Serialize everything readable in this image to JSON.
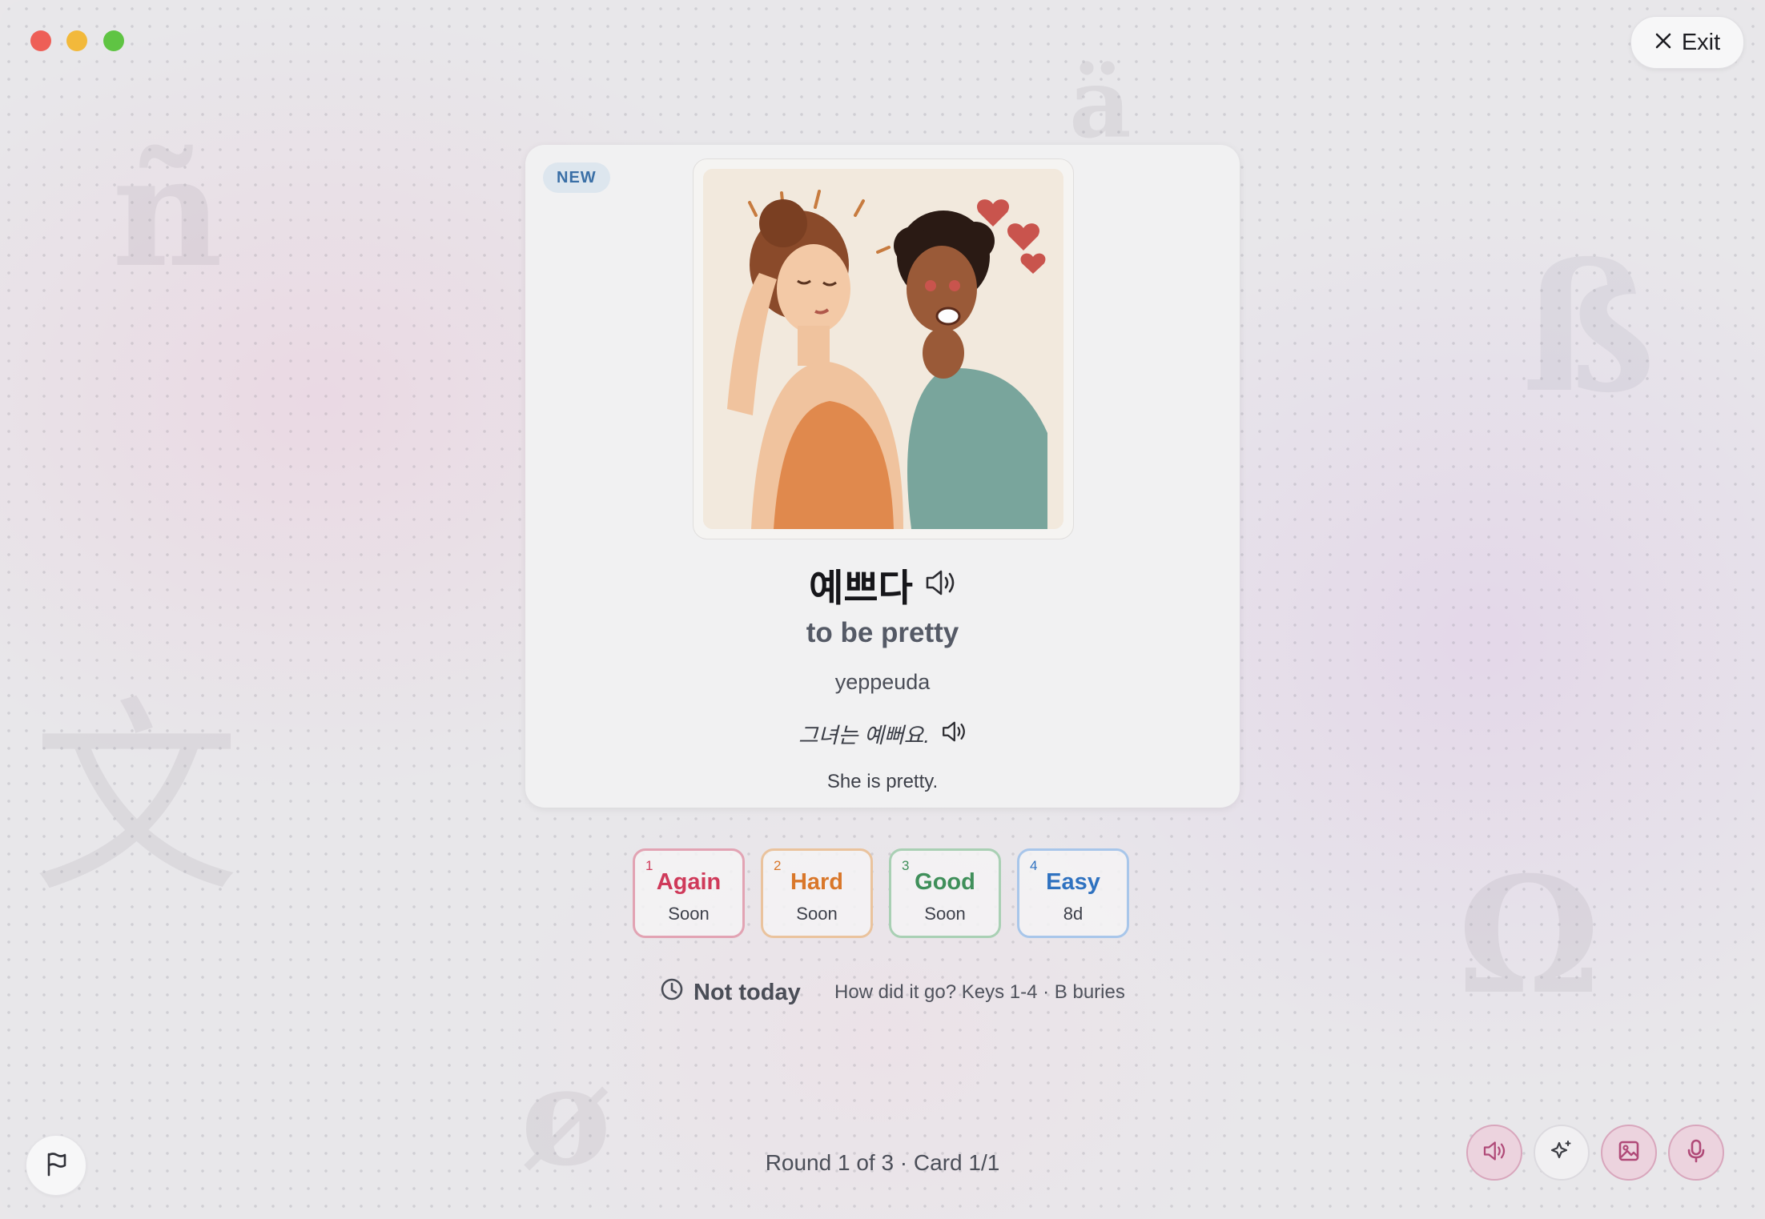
{
  "window": {
    "traffic_lights": {
      "close_color": "#ee5f57",
      "minimize_color": "#f2b93b",
      "maximize_color": "#5fc443"
    },
    "exit_label": "Exit"
  },
  "background": {
    "glyphs": [
      "ñ",
      "ß",
      "文",
      "Ω",
      "ø",
      "ä"
    ]
  },
  "card": {
    "badge": "NEW",
    "image": {
      "description_icon": "illustration-couple"
    },
    "word": "예쁘다",
    "meaning": "to be pretty",
    "romanization": "yeppeuda",
    "example": "그녀는 예뻐요.",
    "translation": "She is pretty."
  },
  "ratings": [
    {
      "key": "1",
      "label": "Again",
      "sub": "Soon",
      "color": "#cf3a5a"
    },
    {
      "key": "2",
      "label": "Hard",
      "sub": "Soon",
      "color": "#d9772a"
    },
    {
      "key": "3",
      "label": "Good",
      "sub": "Soon",
      "color": "#3f8f5a"
    },
    {
      "key": "4",
      "label": "Easy",
      "sub": "8d",
      "color": "#2f72c0"
    }
  ],
  "actions": {
    "not_today": "Not today",
    "hint": "How did it go? Keys 1-4 · B buries"
  },
  "footer": {
    "progress": "Round 1 of 3 · Card 1/1",
    "tools": [
      "speaker-icon",
      "sparkle-icon",
      "image-icon",
      "microphone-icon"
    ]
  }
}
